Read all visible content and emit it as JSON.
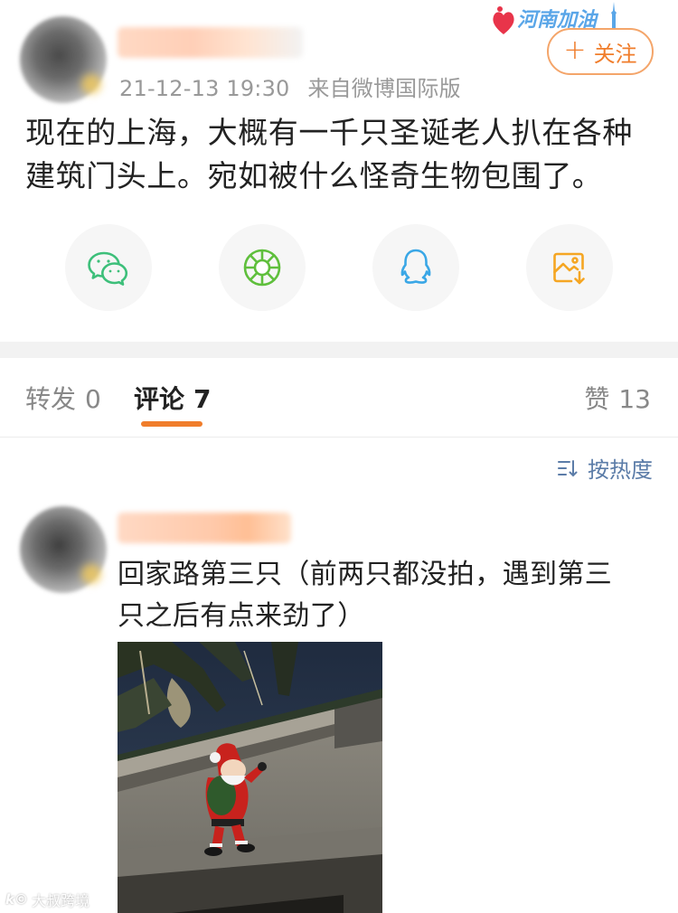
{
  "post": {
    "timestamp": "21-12-13 19:30",
    "source": "来自微博国际版",
    "text_line1": "现在的上海，大概有一千只圣诞老人扒在各种",
    "text_line2": "建筑门头上。宛如被什么怪奇生物包围了。",
    "follow_label": "关注",
    "follow_plus": "+",
    "banner_text": "河南加油"
  },
  "share": [
    {
      "icon": "wechat-icon",
      "color": "#3dbf7a"
    },
    {
      "icon": "moments-icon",
      "color": "#5fbf3c"
    },
    {
      "icon": "qq-icon",
      "color": "#3aa7e6"
    },
    {
      "icon": "save-image-icon",
      "color": "#f5a623"
    }
  ],
  "tabs": {
    "repost_label": "转发",
    "repost_count": "0",
    "comment_label": "评论",
    "comment_count": "7",
    "like_label": "赞",
    "like_count": "13",
    "accent": "#f07d2b"
  },
  "sort_label": "按热度",
  "comment": {
    "text_line1": "回家路第三只（前两只都没拍，遇到第三",
    "text_line2": "只之后有点来劲了）"
  },
  "watermark": {
    "logo": "k©",
    "text": "大叔跨境"
  }
}
